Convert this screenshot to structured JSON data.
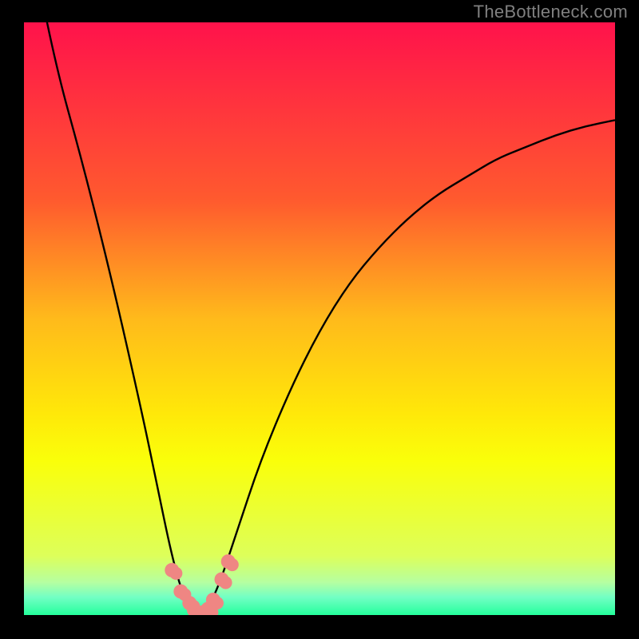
{
  "watermark": "TheBottleneck.com",
  "chart_data": {
    "type": "line",
    "title": "",
    "xlabel": "",
    "ylabel": "",
    "xlim": [
      0,
      100
    ],
    "ylim": [
      0,
      100
    ],
    "background_gradient": {
      "stops": [
        {
          "offset": 0.0,
          "color": "#ff124b"
        },
        {
          "offset": 0.3,
          "color": "#ff5a2e"
        },
        {
          "offset": 0.5,
          "color": "#ffba1b"
        },
        {
          "offset": 0.66,
          "color": "#ffe809"
        },
        {
          "offset": 0.74,
          "color": "#faff0a"
        },
        {
          "offset": 0.9,
          "color": "#ddff5a"
        },
        {
          "offset": 0.945,
          "color": "#b5ffa1"
        },
        {
          "offset": 0.97,
          "color": "#72ffc4"
        },
        {
          "offset": 1.0,
          "color": "#24ff9c"
        }
      ]
    },
    "curve": {
      "comment": "y is bottleneck % (0 at minimum, ~95 at edges). x in 0..100",
      "x": [
        0,
        5,
        10,
        15,
        20,
        22.5,
        25,
        27,
        29,
        30,
        31,
        33,
        36,
        40,
        45,
        50,
        55,
        60,
        65,
        70,
        75,
        80,
        85,
        90,
        95,
        100
      ],
      "y": [
        120,
        94,
        76,
        56,
        34,
        22,
        10,
        3,
        0.5,
        0,
        1,
        5,
        14,
        26,
        38,
        48,
        56,
        62,
        67,
        71,
        74,
        77,
        79,
        81,
        82.5,
        83.5
      ]
    },
    "highlight_points": {
      "color": "#ef8683",
      "radius_px": 9,
      "jitter": 1.2,
      "points": [
        {
          "x": 25.0,
          "y": 7.5
        },
        {
          "x": 26.5,
          "y": 4.0
        },
        {
          "x": 28.0,
          "y": 2.0
        },
        {
          "x": 28.8,
          "y": 0.8
        },
        {
          "x": 30.2,
          "y": 0.5
        },
        {
          "x": 31.2,
          "y": 1.0
        },
        {
          "x": 32.0,
          "y": 2.5
        },
        {
          "x": 33.5,
          "y": 6.0
        },
        {
          "x": 34.5,
          "y": 9.0
        }
      ]
    }
  }
}
